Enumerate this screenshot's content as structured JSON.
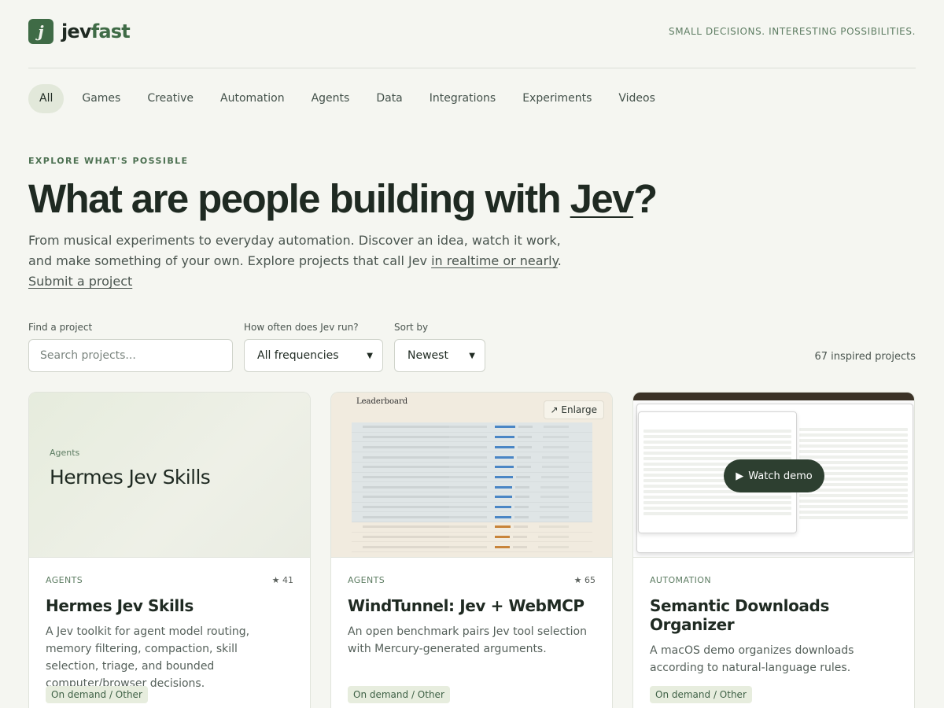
{
  "brand": {
    "name_part1": "jev",
    "name_part2": "fast",
    "logo_letter": "j",
    "tagline": "SMALL DECISIONS. INTERESTING POSSIBILITIES."
  },
  "nav": {
    "items": [
      "All",
      "Games",
      "Creative",
      "Automation",
      "Agents",
      "Data",
      "Integrations",
      "Experiments",
      "Videos"
    ],
    "active": "All"
  },
  "hero": {
    "eyebrow": "EXPLORE WHAT'S POSSIBLE",
    "title_before": "What are people building with ",
    "title_link": "Jev",
    "title_after": "?",
    "lede_text": "From musical experiments to everyday automation. Discover an idea, watch it work, and make something of your own. Explore projects that call Jev ",
    "lede_link": "in realtime or nearly",
    "lede_end": ".",
    "submit_link": "Submit a project"
  },
  "filters": {
    "search_label": "Find a project",
    "search_placeholder": "Search projects...",
    "frequency_label": "How often does Jev run?",
    "frequency_value": "All frequencies",
    "sort_label": "Sort by",
    "sort_value": "Newest",
    "count_text": "67 inspired projects"
  },
  "cards": [
    {
      "category": "AGENTS",
      "stars": "★ 41",
      "title": "Hermes Jev Skills",
      "description": "A Jev toolkit for agent model routing, memory filtering, compaction, skill selection, triage, and bounded computer/browser decisions.",
      "tag": "On demand / Other",
      "thumb_category": "Agents",
      "thumb_title": "Hermes Jev Skills"
    },
    {
      "category": "AGENTS",
      "stars": "★ 65",
      "title": "WindTunnel: Jev + WebMCP",
      "description": "An open benchmark pairs Jev tool selection with Mercury-generated arguments.",
      "tag": "On demand / Other",
      "thumb_label": "Leaderboard",
      "enlarge_label": "↗ Enlarge"
    },
    {
      "category": "AUTOMATION",
      "stars": "",
      "title": "Semantic Downloads Organizer",
      "description": "A macOS demo organizes downloads according to natural-language rules.",
      "tag": "On demand / Other",
      "watch_label": "Watch demo"
    }
  ],
  "colors": {
    "background": "#f5f6f1",
    "accent": "#3f6b46",
    "active_nav": "#e2e8da",
    "tag_bg": "#e7edde",
    "watch_button": "#2d3f30"
  }
}
